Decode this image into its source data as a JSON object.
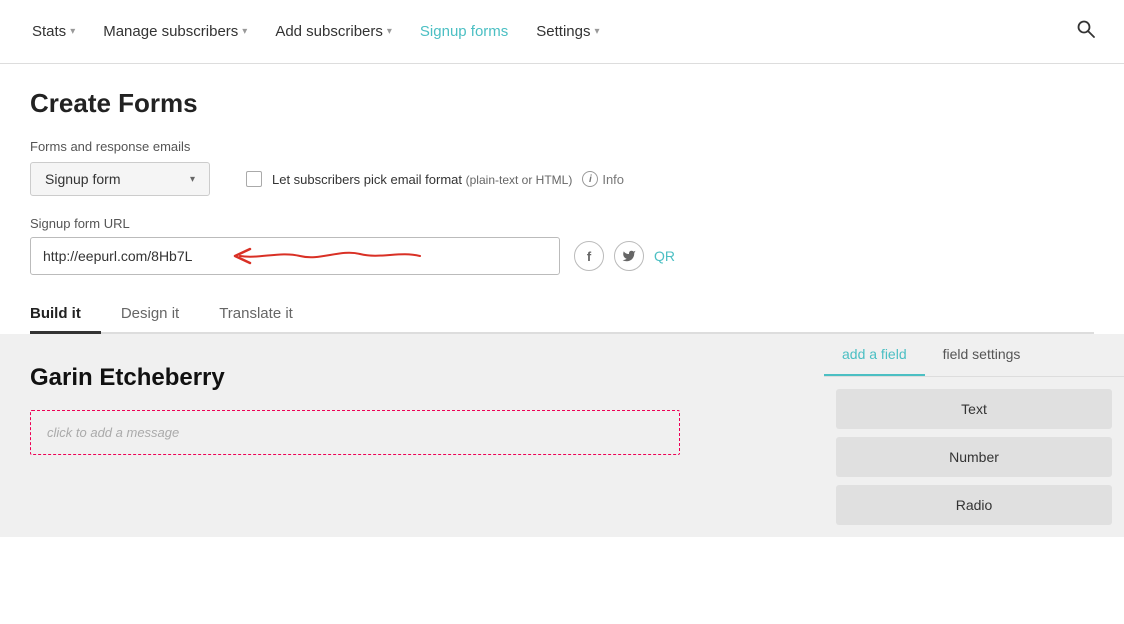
{
  "nav": {
    "items": [
      {
        "id": "stats",
        "label": "Stats",
        "has_chevron": true,
        "active": false
      },
      {
        "id": "manage-subscribers",
        "label": "Manage subscribers",
        "has_chevron": true,
        "active": false
      },
      {
        "id": "add-subscribers",
        "label": "Add subscribers",
        "has_chevron": true,
        "active": false
      },
      {
        "id": "signup-forms",
        "label": "Signup forms",
        "has_chevron": false,
        "active": true
      },
      {
        "id": "settings",
        "label": "Settings",
        "has_chevron": true,
        "active": false
      }
    ],
    "search_icon": "🔍"
  },
  "page": {
    "title": "Create Forms",
    "forms_label": "Forms and response emails",
    "dropdown_value": "Signup form",
    "checkbox_label": "Let subscribers pick email format",
    "checkbox_sublabel": "(plain-text or HTML)",
    "info_label": "Info",
    "url_label": "Signup form URL",
    "url_value": "http://eepurl.com/8Hb7L",
    "qr_label": "QR"
  },
  "tabs": [
    {
      "id": "build-it",
      "label": "Build it",
      "active": true
    },
    {
      "id": "design-it",
      "label": "Design it",
      "active": false
    },
    {
      "id": "translate-it",
      "label": "Translate it",
      "active": false
    }
  ],
  "builder": {
    "title": "Garin Etcheberry",
    "message_placeholder": "click to add a message"
  },
  "right_panel": {
    "tabs": [
      {
        "id": "add-a-field",
        "label": "add a field",
        "active": true
      },
      {
        "id": "field-settings",
        "label": "field settings",
        "active": false
      }
    ],
    "field_buttons": [
      {
        "id": "text",
        "label": "Text"
      },
      {
        "id": "number",
        "label": "Number"
      },
      {
        "id": "radio",
        "label": "Radio"
      }
    ]
  }
}
